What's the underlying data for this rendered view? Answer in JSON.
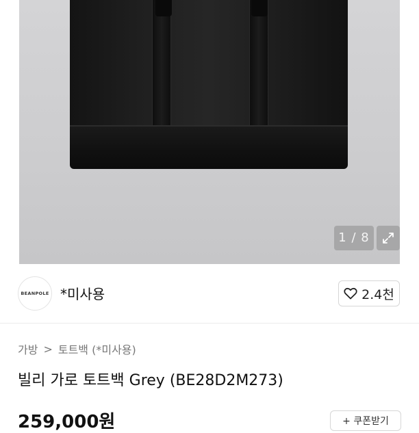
{
  "gallery": {
    "counter": "1 / 8",
    "expand_icon": "expand-icon"
  },
  "seller": {
    "logo_text": "BEANPOLE",
    "name": "*미사용"
  },
  "like": {
    "icon": "heart-icon",
    "count": "2.4천"
  },
  "breadcrumb": {
    "category": "가방",
    "separator": ">",
    "subcategory": "토트백 (*미사용)"
  },
  "product": {
    "title": "빌리 가로 토트백 Grey (BE28D2M273)",
    "price": "259,000원",
    "coupon_label": "+ 쿠폰받기"
  },
  "colors": {
    "bag": "#1c1c1c",
    "background": "#cfcfd1",
    "text": "#111111",
    "muted": "#777777"
  }
}
